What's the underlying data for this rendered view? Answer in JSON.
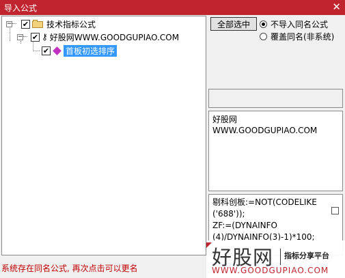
{
  "window": {
    "title": "导入公式",
    "close_glyph": "✕"
  },
  "tree": {
    "root": {
      "label": "技术指标公式",
      "checked": true,
      "expander": "−"
    },
    "child": {
      "label": "好股网WWW.GOODGUPIAO.COM",
      "checked": true,
      "expander": "−"
    },
    "leaf": {
      "label": "首板初选排序",
      "checked": true,
      "selected": true
    }
  },
  "controls": {
    "select_all_label": "全部选中",
    "radio_no_import": "不导入同名公式",
    "radio_overwrite": "覆盖同名(非系统)"
  },
  "info": {
    "line1": "好股网",
    "line2": "WWW.GOODGUPIAO.COM"
  },
  "code": {
    "line1": "剔科创板:=NOT(CODELIKE",
    "line2": "('688'));",
    "line3": "ZF:=(DYNAINFO",
    "line4": "(4)/DYNAINFO(3)-1)*100;"
  },
  "status": "系统存在同名公式, 再次点击可以更名",
  "watermark": {
    "brand": "好股网",
    "tagline": "指标分享平台",
    "url": "WWW.GOODGUPIAO.COM"
  },
  "colors": {
    "titlebar": "#c0242e",
    "selection": "#3399ff",
    "status_text": "#c00000"
  }
}
